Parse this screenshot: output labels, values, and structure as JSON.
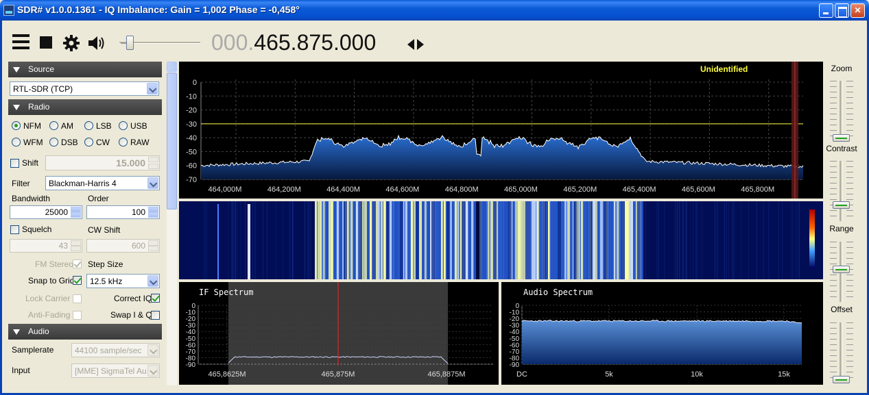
{
  "window": {
    "title": "SDR# v1.0.0.1361 - IQ Imbalance: Gain = 1,002 Phase = -0,458°"
  },
  "toolbar": {
    "frequency_prefix": "000.",
    "frequency_main": "465.875.000",
    "volume_level": 0.1
  },
  "source": {
    "header": "Source",
    "device": "RTL-SDR (TCP)"
  },
  "radio": {
    "header": "Radio",
    "modes": [
      "NFM",
      "AM",
      "LSB",
      "USB",
      "WFM",
      "DSB",
      "CW",
      "RAW"
    ],
    "selected_mode": "NFM",
    "shift_label": "Shift",
    "shift_value": "15.000",
    "filter_label": "Filter",
    "filter_value": "Blackman-Harris 4",
    "bandwidth_label": "Bandwidth",
    "bandwidth_value": "25000",
    "order_label": "Order",
    "order_value": "100",
    "squelch_label": "Squelch",
    "squelch_value": "43",
    "cwshift_label": "CW Shift",
    "cwshift_value": "600",
    "fmstereo_label": "FM Stereo",
    "stepsize_label": "Step Size",
    "snaptogrid_label": "Snap to Grid",
    "stepsize_value": "12.5 kHz",
    "lockcarrier_label": "Lock Carrier",
    "correctiq_label": "Correct IQ",
    "antifading_label": "Anti-Fading",
    "swapiq_label": "Swap I & Q"
  },
  "audio": {
    "header": "Audio",
    "samplerate_label": "Samplerate",
    "samplerate_value": "44100 sample/sec",
    "input_label": "Input",
    "input_value": "[MME] SigmaTel Audio"
  },
  "main_spectrum": {
    "label": "Unidentified",
    "y_ticks": [
      "0",
      "-10",
      "-20",
      "-30",
      "-40",
      "-50",
      "-60",
      "-70"
    ],
    "x_ticks": [
      "464,000M",
      "464,200M",
      "464,400M",
      "464,600M",
      "464,800M",
      "465,000M",
      "465,200M",
      "465,400M",
      "465,600M",
      "465,800M"
    ],
    "squelch_level_db": -30,
    "accent_color": "#FFFF40"
  },
  "if_spectrum": {
    "title": "IF Spectrum",
    "y_ticks": [
      "0",
      "-10",
      "-20",
      "-30",
      "-40",
      "-50",
      "-60",
      "-70",
      "-80",
      "-90"
    ],
    "x_ticks": [
      "465,8625M",
      "465,875M",
      "465,8875M"
    ]
  },
  "audio_spectrum": {
    "title": "Audio Spectrum",
    "y_ticks": [
      "0",
      "-10",
      "-20",
      "-30",
      "-40",
      "-50",
      "-60",
      "-70",
      "-80",
      "-90"
    ],
    "x_ticks": [
      "DC",
      "5k",
      "10k",
      "15k"
    ]
  },
  "right_sliders": {
    "zoom_label": "Zoom",
    "contrast_label": "Contrast",
    "range_label": "Range",
    "offset_label": "Offset",
    "zoom_value": 0.0,
    "contrast_value": 0.25,
    "range_value": 0.55,
    "offset_value": 0.0
  }
}
